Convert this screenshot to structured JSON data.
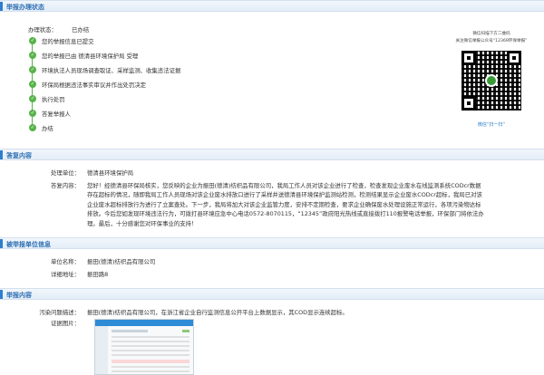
{
  "sections": {
    "status": "举报办理状态",
    "reply": "答复内容",
    "reported": "被举报单位信息",
    "report": "举报内容"
  },
  "status": {
    "label": "办理状态：",
    "value": "已办结",
    "steps": [
      "您的举报信息已提交",
      "您的举报已由 德清县环境保护局 受理",
      "环境执法人员现场调查取证、采样监测、收集违法证据",
      "环保局根据违法事实审议并作出处罚决定",
      "执行处罚",
      "答复举报人",
      "办结"
    ]
  },
  "qr": {
    "caption_line1": "微信扫描下方二维码",
    "caption_line2": "关注微信举报公众号“12369环保举报”",
    "footer": "微信“扫一扫”"
  },
  "reply": {
    "unit_label": "处理单位：",
    "unit_value": "德清县环境保护局",
    "content_label": "答复内容：",
    "content_value": "您好！经德清县环保局核实，您反映的企业为振田(德清)纺织品有限公司，我局工作人员对该企业进行了检查，检查发现企业废水在线监测系统CODcr数据存在超标的情况，随即我局工作人员现场对该企业废水排放口进行了采样并送德清县环境保护监测站检测，检测结果显示企业废水CODcr超标，我局已对该企业废水超标排放行为进行了立案查处。下一步，我局将加大对该企业监管力度，安排不定期检查，要求企业确保废水处理设施正常运行，各项污染物达标排放。今后您如发现环境违法行为，可拨打县环境应急中心电话0572-8070115，“12345”政府阳光热线或直接拨打110报警电话举报，环保部门将依法办理。最后，十分感谢您对环保事业的支持！"
  },
  "reported": {
    "name_label": "单位名称：",
    "name_value": "振田(德清)纺织品有限公司",
    "addr_label": "详细地址：",
    "addr_value": "振田路8"
  },
  "report": {
    "desc_label": "污染问题描述：",
    "desc_value": "振田(德清)纺织品有限公司，在浙江省企业自行监测信息公开平台上数据显示，其COD显示连续超标。",
    "img_label": "证据图片："
  },
  "colors": {
    "accent": "#2d7fcd",
    "step_done": "#57b34a"
  },
  "icons": {
    "step": "check-circle-icon",
    "section": "section-bar-icon"
  }
}
